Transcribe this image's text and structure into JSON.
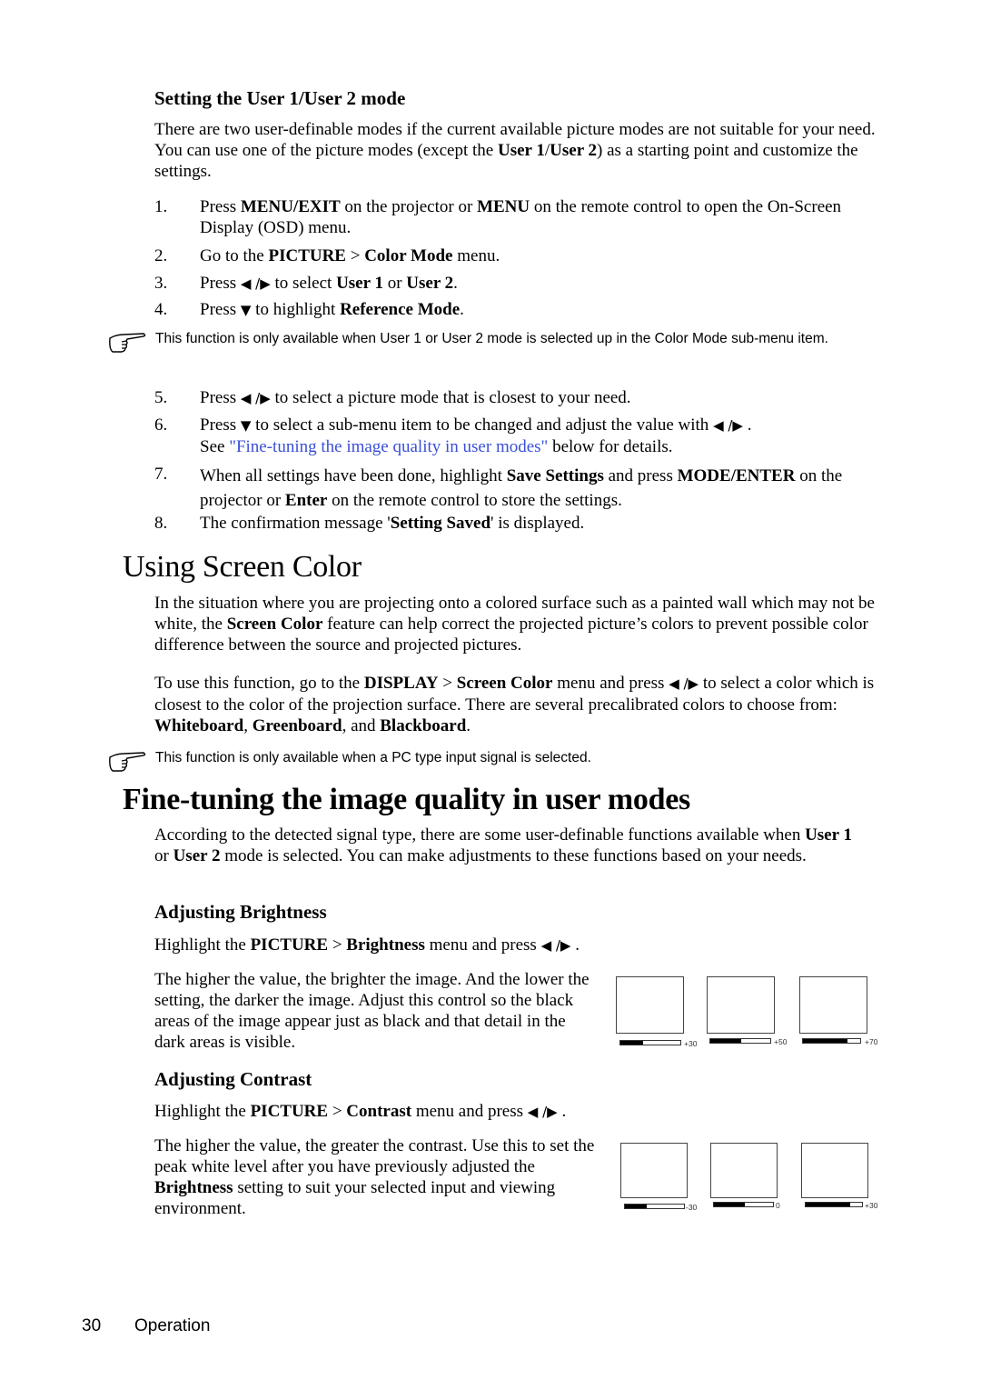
{
  "user_mode_section": {
    "heading": "Setting the User 1/User 2 mode",
    "intro": {
      "p1": "There are two user-definable modes if the current available picture modes are not suitable for your need. You can use one of the picture modes (except the ",
      "b1": "User 1",
      "p2": "/",
      "b2": "User 2",
      "p3": ") as a starting point and customize the settings."
    },
    "steps_a": [
      {
        "num": "1.",
        "t1": "Press ",
        "b1": "MENU/EXIT",
        "t2": " on the projector or ",
        "b2": "MENU",
        "t3": " on the remote control to open the On-Screen Display (OSD) menu."
      },
      {
        "num": "2.",
        "t1": "Go to the ",
        "b1": "PICTURE",
        "t2": " > ",
        "b2": "Color Mode",
        "t3": " menu."
      },
      {
        "num": "3.",
        "t1": "Press ",
        "arrows": "◀ /▶",
        "t2": " to select ",
        "b1": "User 1",
        "t3": " or ",
        "b2": "User 2",
        "t4": "."
      },
      {
        "num": "4.",
        "t1": "Press ",
        "arrows": "▼",
        "t2": " to highlight ",
        "b1": "Reference Mode",
        "t3": "."
      }
    ],
    "note": "This function is only available when User 1 or User 2 mode is selected up in the Color Mode sub-menu item.",
    "steps_b": [
      {
        "num": "5.",
        "t1": "Press ",
        "arrows": "◀ /▶",
        "t2": " to select a picture mode that is closest to your need."
      },
      {
        "num": "6.",
        "t1": "Press ",
        "arrows": "▼",
        "t2": " to select a sub-menu item to be changed and adjust the value with ",
        "arrows2": "◀ /▶",
        "t3": " .",
        "line2_pre": "See ",
        "link": "\"Fine-tuning the image quality in user modes\"",
        "line2_post": " below for details."
      },
      {
        "num": "7.",
        "t1": "When all settings have been done, highlight ",
        "b1": "Save Settings",
        "t2": " and press ",
        "b2": "MODE/ENTER",
        "t3": " on the projector or ",
        "b3": "Enter",
        "t4": " on the remote control to store the settings."
      },
      {
        "num": "8.",
        "t1": "The confirmation message '",
        "b1": "Setting Saved",
        "t2": "' is displayed."
      }
    ]
  },
  "screen_color_section": {
    "heading": "Using Screen Color",
    "p1": {
      "t1": "In the situation where you are projecting onto a colored surface such as a painted wall which may not be white, the ",
      "b1": "Screen Color",
      "t2": " feature can help correct the projected picture’s colors to prevent possible color difference between the source and projected pictures."
    },
    "p2": {
      "t1": "To use this function, go to the ",
      "b1": "DISPLAY",
      "t2": " > ",
      "b2": "Screen Color",
      "t3": " menu and press ",
      "arrows": "◀ /▶",
      "t4": " to select a color which is closest to the color of the projection surface. There are several precalibrated colors to choose from: ",
      "b3": "Whiteboard",
      "t5": ", ",
      "b4": "Greenboard",
      "t6": ", and ",
      "b5": "Blackboard",
      "t7": "."
    },
    "note": "This function is only available when a PC type input signal is selected."
  },
  "fine_tuning_section": {
    "heading": "Fine-tuning the image quality in user modes",
    "intro": {
      "t1": "According to the detected signal type, there are some user-definable functions available when ",
      "b1": "User 1",
      "t2": " or ",
      "b2": "User 2",
      "t3": " mode is selected. You can make adjustments to these functions based on your needs."
    },
    "brightness": {
      "heading": "Adjusting Brightness",
      "instr": {
        "t1": "Highlight the ",
        "b1": "PICTURE",
        "t2": " > ",
        "b2": "Brightness",
        "t3": " menu and press ",
        "arrows": "◀ /▶",
        "t4": " ."
      },
      "desc": "The higher the value, the brighter the image. And the lower the setting, the darker the image. Adjust this control so the black areas of the image appear just as black and that detail in the dark areas is visible.",
      "figures": [
        {
          "label": "+30",
          "fill": 0.38
        },
        {
          "label": "+50",
          "fill": 0.52
        },
        {
          "label": "+70",
          "fill": 0.77
        }
      ]
    },
    "contrast": {
      "heading": "Adjusting Contrast",
      "instr": {
        "t1": "Highlight the ",
        "b1": "PICTURE",
        "t2": " > ",
        "b2": "Contrast",
        "t3": " menu and press ",
        "arrows": "◀ /▶",
        "t4": " ."
      },
      "desc": {
        "t1": "The higher the value, the greater the contrast. Use this to set the peak white level after you have previously adjusted the ",
        "b1": "Brightness",
        "t2": " setting to suit your selected input and viewing environment."
      },
      "figures": [
        {
          "label": "-30",
          "fill": 0.37
        },
        {
          "label": "0",
          "fill": 0.52
        },
        {
          "label": "+30",
          "fill": 0.79
        }
      ]
    }
  },
  "footer": {
    "page_number": "30",
    "section": "Operation"
  },
  "colors": {
    "link": "#3a4fd8",
    "text": "#000000"
  }
}
